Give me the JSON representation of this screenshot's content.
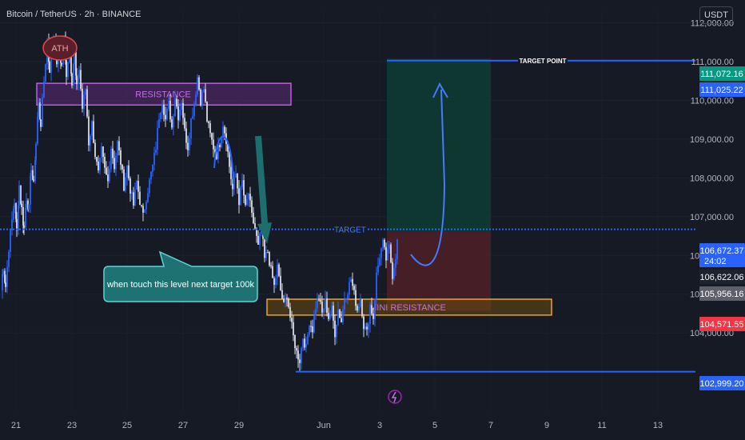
{
  "header": {
    "symbol": "Bitcoin / TetherUS · 2h · BINANCE",
    "currency": "USDT"
  },
  "chart_data": {
    "type": "candlestick",
    "x_ticks": [
      "21",
      "23",
      "25",
      "27",
      "29",
      "Jun",
      "3",
      "5",
      "7",
      "9",
      "11",
      "13"
    ],
    "y_ticks": [
      "104,000.00",
      "105,000.00",
      "106,000.00",
      "107,000.00",
      "108,000.00",
      "109,000.00",
      "110,000.00",
      "111,000.00",
      "112,000.00"
    ],
    "ylim": [
      102600,
      112300
    ],
    "price_labels": [
      {
        "value": 111072.16,
        "text": "111,072.16",
        "color": "#089981"
      },
      {
        "value": 111025.22,
        "text": "111,025.22",
        "color": "#2962ff"
      },
      {
        "value": 106672.37,
        "text": "106,672.37",
        "color": "#2962ff",
        "countdown": "24:02"
      },
      {
        "value": 106622.06,
        "text": "106,622.06",
        "color": "#1e222d"
      },
      {
        "value": 105956.16,
        "text": "105,956.16",
        "color": "#5d606b"
      },
      {
        "value": 104571.55,
        "text": "104,571.55",
        "color": "#f23645"
      },
      {
        "value": 102999.2,
        "text": "102,999.20",
        "color": "#2962ff"
      }
    ],
    "annotations": {
      "ath": "ATH",
      "resistance": "RESISTANCE",
      "target": "TARGET",
      "target_point": "TARGET POINT",
      "mini_resistance": "MINI RESISTANCE",
      "callout": "when touch this level next target 100k"
    },
    "levels": {
      "target": 106672.37,
      "target_point": 111025.22,
      "support": 102999.2,
      "resistance_zone": [
        109880,
        110440
      ],
      "mini_resistance_zone": [
        104460,
        104870
      ],
      "position_entry": 106622.06,
      "position_stop": 104571.55,
      "position_take_profit": 111072.16
    },
    "series": [
      {
        "name": "",
        "close_path": [
          [
            0,
            105100
          ],
          [
            3,
            105700
          ],
          [
            6,
            105200
          ],
          [
            10,
            106200
          ],
          [
            14,
            106900
          ],
          [
            17,
            107400
          ],
          [
            20,
            106600
          ],
          [
            23,
            107800
          ],
          [
            26,
            107200
          ],
          [
            29,
            106700
          ],
          [
            32,
            107500
          ],
          [
            35,
            107200
          ],
          [
            38,
            108300
          ],
          [
            41,
            107800
          ],
          [
            44,
            108900
          ],
          [
            47,
            109900
          ],
          [
            50,
            109400
          ],
          [
            54,
            110500
          ],
          [
            58,
            111500
          ],
          [
            61,
            110800
          ],
          [
            64,
            111400
          ],
          [
            67,
            111700
          ],
          [
            70,
            111000
          ],
          [
            73,
            111300
          ],
          [
            76,
            110900
          ],
          [
            79,
            111600
          ],
          [
            82,
            110700
          ],
          [
            86,
            111400
          ],
          [
            89,
            110500
          ],
          [
            92,
            111200
          ],
          [
            95,
            110300
          ],
          [
            98,
            110800
          ],
          [
            102,
            109800
          ],
          [
            106,
            110300
          ],
          [
            110,
            108900
          ],
          [
            114,
            109400
          ],
          [
            118,
            108600
          ],
          [
            122,
            108100
          ],
          [
            126,
            108700
          ],
          [
            130,
            108200
          ],
          [
            134,
            107900
          ],
          [
            138,
            108800
          ],
          [
            142,
            108300
          ],
          [
            146,
            108900
          ],
          [
            150,
            108400
          ],
          [
            154,
            107800
          ],
          [
            158,
            108300
          ],
          [
            162,
            107700
          ],
          [
            166,
            107300
          ],
          [
            170,
            107900
          ],
          [
            174,
            107400
          ],
          [
            178,
            107000
          ],
          [
            182,
            107500
          ],
          [
            186,
            107900
          ],
          [
            190,
            108300
          ],
          [
            194,
            108800
          ],
          [
            198,
            109600
          ],
          [
            202,
            110000
          ],
          [
            206,
            109500
          ],
          [
            210,
            109900
          ],
          [
            214,
            109300
          ],
          [
            218,
            110100
          ],
          [
            222,
            109600
          ],
          [
            226,
            110000
          ],
          [
            230,
            109200
          ],
          [
            234,
            108800
          ],
          [
            238,
            109500
          ],
          [
            242,
            109900
          ],
          [
            246,
            110600
          ],
          [
            250,
            110000
          ],
          [
            254,
            110300
          ],
          [
            258,
            109500
          ],
          [
            262,
            109100
          ],
          [
            266,
            108800
          ],
          [
            270,
            108600
          ],
          [
            274,
            108900
          ],
          [
            278,
            109400
          ],
          [
            282,
            109000
          ],
          [
            286,
            108300
          ],
          [
            290,
            107700
          ],
          [
            294,
            108100
          ],
          [
            298,
            107400
          ],
          [
            302,
            107900
          ],
          [
            306,
            107200
          ],
          [
            310,
            107600
          ],
          [
            314,
            107000
          ],
          [
            318,
            106700
          ],
          [
            322,
            106200
          ],
          [
            326,
            106700
          ],
          [
            330,
            105900
          ],
          [
            334,
            106100
          ],
          [
            338,
            105600
          ],
          [
            342,
            105200
          ],
          [
            346,
            105700
          ],
          [
            350,
            105100
          ],
          [
            354,
            104700
          ],
          [
            358,
            105000
          ],
          [
            362,
            104400
          ],
          [
            366,
            103900
          ],
          [
            370,
            103500
          ],
          [
            374,
            103300
          ],
          [
            378,
            103900
          ],
          [
            382,
            103600
          ],
          [
            386,
            104300
          ],
          [
            390,
            104100
          ],
          [
            394,
            104700
          ],
          [
            398,
            104900
          ],
          [
            402,
            104500
          ],
          [
            406,
            104800
          ],
          [
            410,
            104400
          ],
          [
            414,
            104600
          ],
          [
            418,
            104000
          ],
          [
            422,
            104600
          ],
          [
            426,
            104300
          ],
          [
            430,
            104900
          ],
          [
            434,
            105100
          ],
          [
            438,
            105400
          ],
          [
            442,
            105000
          ],
          [
            446,
            104600
          ],
          [
            450,
            104900
          ],
          [
            454,
            104200
          ],
          [
            458,
            104000
          ],
          [
            462,
            104700
          ],
          [
            466,
            104400
          ],
          [
            470,
            105500
          ],
          [
            474,
            106000
          ],
          [
            478,
            106300
          ],
          [
            482,
            105900
          ],
          [
            486,
            106200
          ],
          [
            490,
            105500
          ],
          [
            494,
            106000
          ],
          [
            498,
            106700
          ]
        ]
      }
    ]
  }
}
